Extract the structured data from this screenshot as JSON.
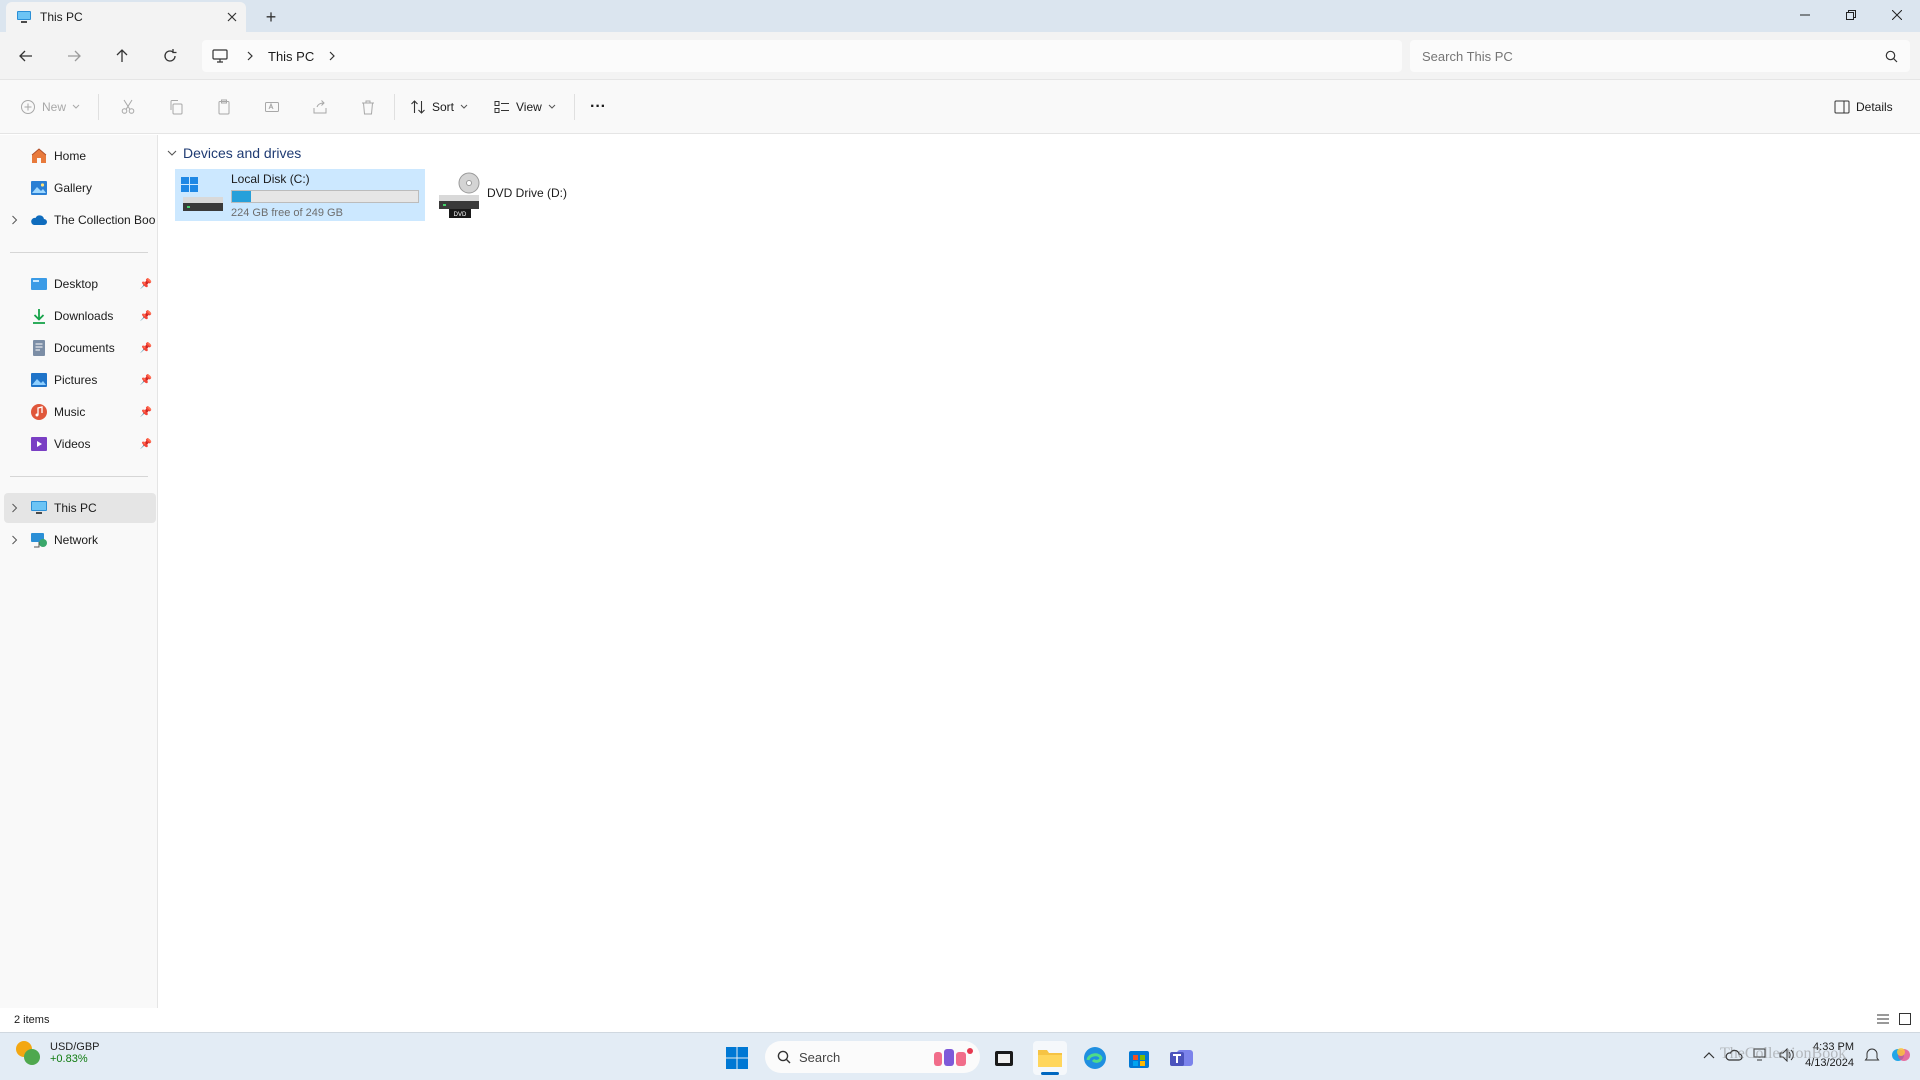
{
  "window": {
    "tab_title": "This PC",
    "new_tab_symbol": "+"
  },
  "nav": {
    "breadcrumb_location": "This PC",
    "search_placeholder": "Search This PC"
  },
  "commands": {
    "new_label": "New",
    "sort_label": "Sort",
    "view_label": "View",
    "more_label": "···",
    "details_label": "Details"
  },
  "sidebar": {
    "top_items": [
      {
        "label": "Home",
        "icon": "home-icon"
      },
      {
        "label": "Gallery",
        "icon": "gallery-icon"
      },
      {
        "label": "The Collection Boo",
        "icon": "onedrive-icon"
      }
    ],
    "pinned_items": [
      {
        "label": "Desktop",
        "icon": "desktop-folder-icon"
      },
      {
        "label": "Downloads",
        "icon": "downloads-icon"
      },
      {
        "label": "Documents",
        "icon": "documents-icon"
      },
      {
        "label": "Pictures",
        "icon": "pictures-icon"
      },
      {
        "label": "Music",
        "icon": "music-icon"
      },
      {
        "label": "Videos",
        "icon": "videos-icon"
      }
    ],
    "bottom_items": [
      {
        "label": "This PC",
        "icon": "this-pc-icon",
        "selected": true
      },
      {
        "label": "Network",
        "icon": "network-icon"
      }
    ]
  },
  "content": {
    "group_title": "Devices and drives",
    "drives": [
      {
        "name": "Local Disk (C:)",
        "free_text": "224 GB free of 249 GB",
        "used_fraction": 0.1,
        "selected": true
      },
      {
        "name": "DVD Drive (D:)",
        "badge": "DVD"
      }
    ]
  },
  "status": {
    "item_count": "2 items"
  },
  "taskbar": {
    "widget_title": "USD/GBP",
    "widget_value": "+0.83%",
    "search_label": "Search",
    "time": "4:33 PM",
    "date": "4/13/2024"
  },
  "watermark": "TheCollectionBook",
  "colors": {
    "accent": "#0067c0",
    "selection": "#cce8ff",
    "progress_fill": "#26a0da",
    "positive": "#0f7b0f"
  }
}
